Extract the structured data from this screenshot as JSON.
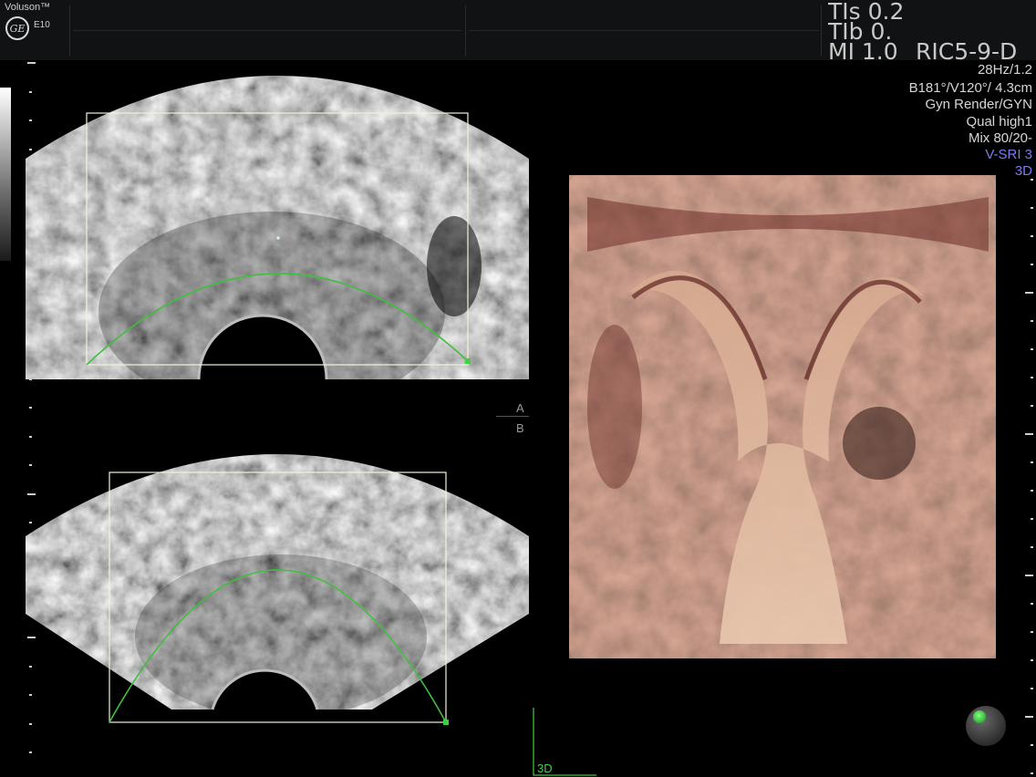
{
  "header": {
    "brand": "Voluson™",
    "logo_text": "GE",
    "model": "E10",
    "tis": "TIs  0.2",
    "tib": "TIb  0.",
    "mi": "MI  1.0",
    "probe": "RIC5-9-D"
  },
  "info_lines": {
    "frame_rate": "28Hz/1.2",
    "angles": "B181°/V120°/ 4.3cm",
    "render_mode": "Gyn Render/GYN",
    "quality": "Qual high1",
    "mix": "Mix 80/20-",
    "vsri": "V-SRI 3",
    "mode": "3D"
  },
  "panel_labels": {
    "a": "A",
    "b": "B",
    "render": "3D"
  },
  "colors": {
    "roi_box": "#f2f2d8",
    "render_curve": "#3fbf3f",
    "blue_text": "#7a7cf0",
    "tissue": "#c89a82"
  },
  "icons": {
    "orientation": "orientation-sphere-icon",
    "logo": "ge-logo-icon"
  }
}
